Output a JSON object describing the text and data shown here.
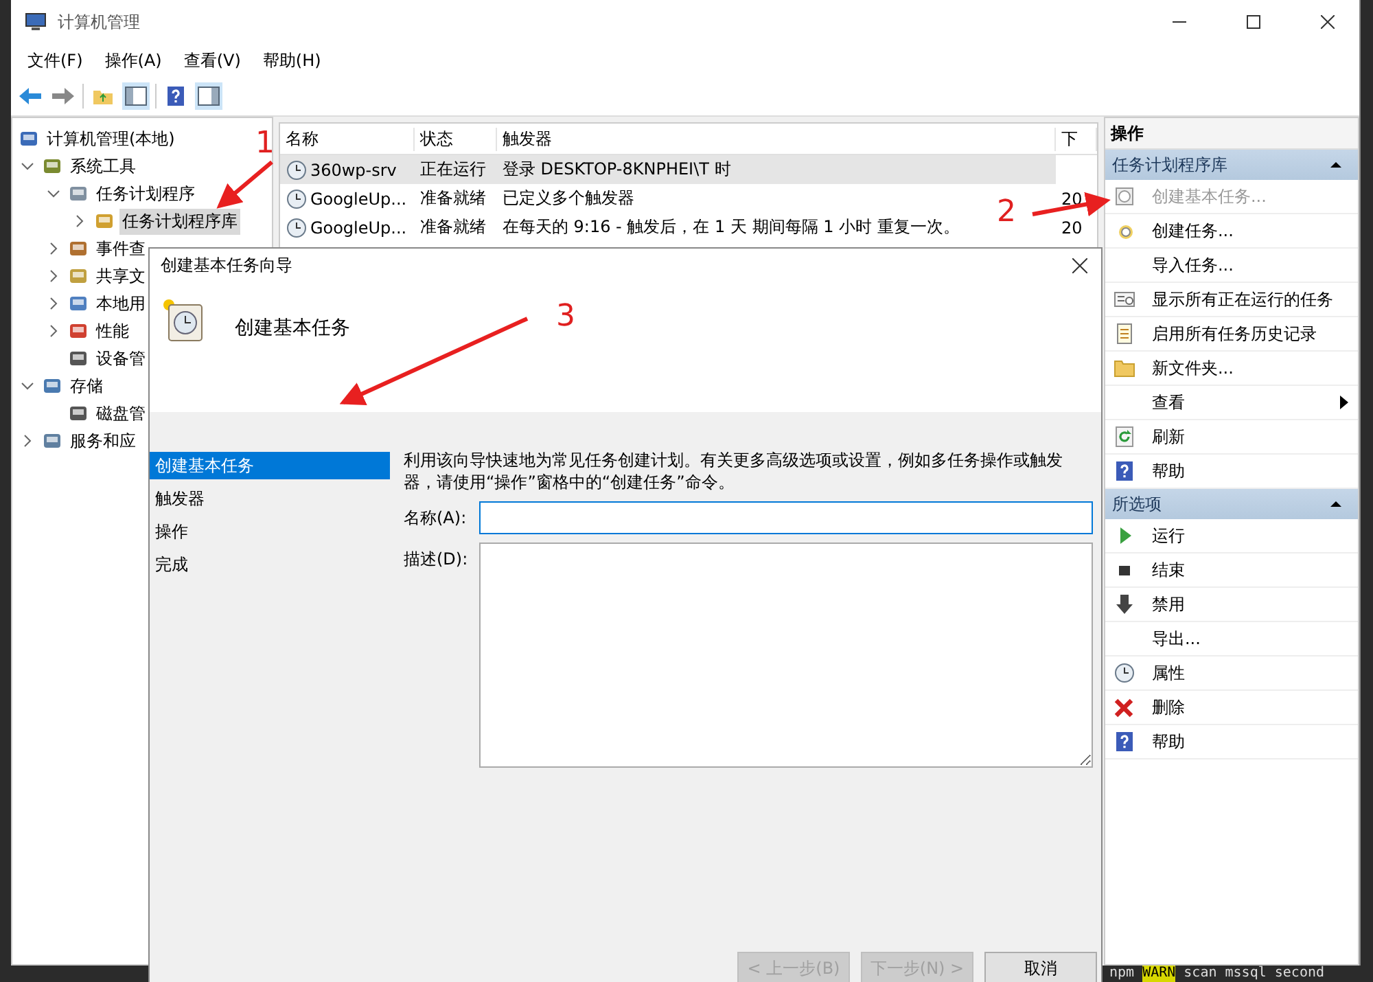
{
  "window": {
    "title": "计算机管理"
  },
  "menu": [
    "文件(F)",
    "操作(A)",
    "查看(V)",
    "帮助(H)"
  ],
  "tree": [
    {
      "label": "计算机管理(本地)",
      "selected": false,
      "children": [
        {
          "label": "系统工具",
          "expanded": true,
          "selected": false,
          "children": [
            {
              "label": "任务计划程序",
              "expanded": true,
              "selected": false,
              "children": [
                {
                  "label": "任务计划程序库",
                  "expanded": false,
                  "selected": true
                }
              ]
            },
            {
              "label": "事件查",
              "expanded": false,
              "selected": false
            },
            {
              "label": "共享文",
              "expanded": false,
              "selected": false
            },
            {
              "label": "本地用",
              "expanded": false,
              "selected": false
            },
            {
              "label": "性能",
              "expanded": false,
              "selected": false
            },
            {
              "label": "设备管",
              "selected": false
            }
          ]
        },
        {
          "label": "存储",
          "expanded": true,
          "selected": false,
          "children": [
            {
              "label": "磁盘管",
              "selected": false
            }
          ]
        },
        {
          "label": "服务和应",
          "expanded": false,
          "selected": false
        }
      ]
    }
  ],
  "table": {
    "columns": [
      "名称",
      "状态",
      "触发器",
      "下"
    ],
    "rows": [
      {
        "name": "360wp-srv",
        "status": "正在运行",
        "trigger": "登录 DESKTOP-8KNPHEI\\T 时",
        "selected": true
      },
      {
        "name": "GoogleUp...",
        "status": "准备就绪",
        "trigger": "已定义多个触发器",
        "column_4": "20",
        "selected": false
      },
      {
        "name": "GoogleUp...",
        "status": "准备就绪",
        "trigger": "在每天的 9:16 - 触发后，在 1 天 期间每隔 1 小时 重复一次。",
        "column_4": "20",
        "selected": false
      }
    ]
  },
  "actions": {
    "title": "操作",
    "sections": [
      {
        "title": "任务计划程序库",
        "expanded": true,
        "items": [
          {
            "label": "创建基本任务...",
            "disabled": true
          },
          {
            "label": "创建任务...",
            "disabled": false
          },
          {
            "label": "导入任务...",
            "disabled": false
          },
          {
            "label": "显示所有正在运行的任务",
            "disabled": false
          },
          {
            "label": "启用所有任务历史记录",
            "disabled": false
          },
          {
            "label": "新文件夹...",
            "disabled": false
          },
          {
            "label": "查看",
            "disabled": false,
            "submenu": true
          },
          {
            "label": "刷新",
            "disabled": false
          },
          {
            "label": "帮助",
            "disabled": false
          }
        ]
      },
      {
        "title": "所选项",
        "expanded": true,
        "items": [
          {
            "label": "运行",
            "disabled": false
          },
          {
            "label": "结束",
            "disabled": false
          },
          {
            "label": "禁用",
            "disabled": false
          },
          {
            "label": "导出...",
            "disabled": false
          },
          {
            "label": "属性",
            "disabled": false
          },
          {
            "label": "删除",
            "disabled": false
          },
          {
            "label": "帮助",
            "disabled": false
          }
        ]
      }
    ]
  },
  "dialog": {
    "title": "创建基本任务向导",
    "heading": "创建基本任务",
    "steps": [
      {
        "label": "创建基本任务",
        "selected": true
      },
      {
        "label": "触发器",
        "selected": false
      },
      {
        "label": "操作",
        "selected": false
      },
      {
        "label": "完成",
        "selected": false
      }
    ],
    "description": "利用该向导快速地为常见任务创建计划。有关更多高级选项或设置，例如多任务操作或触发器，请使用“操作”窗格中的“创建任务”命令。",
    "fields": [
      {
        "label": "名称(A):",
        "kind": "input",
        "focused": true
      },
      {
        "label": "描述(D):",
        "kind": "textarea",
        "focused": false
      }
    ],
    "buttons": [
      {
        "label": "< 上一步(B)",
        "disabled": true
      },
      {
        "label": "下一步(N) >",
        "disabled": true
      },
      {
        "label": "取消",
        "disabled": false
      }
    ]
  },
  "annotations": [
    {
      "number": "1"
    },
    {
      "number": "2"
    },
    {
      "number": "3"
    }
  ],
  "terminal": {
    "tokens": [
      {
        "text": "npm",
        "kind": "plain"
      },
      {
        "text": "WARN",
        "kind": "warn"
      },
      {
        "text": "scan mssql second",
        "kind": "plain"
      }
    ]
  }
}
